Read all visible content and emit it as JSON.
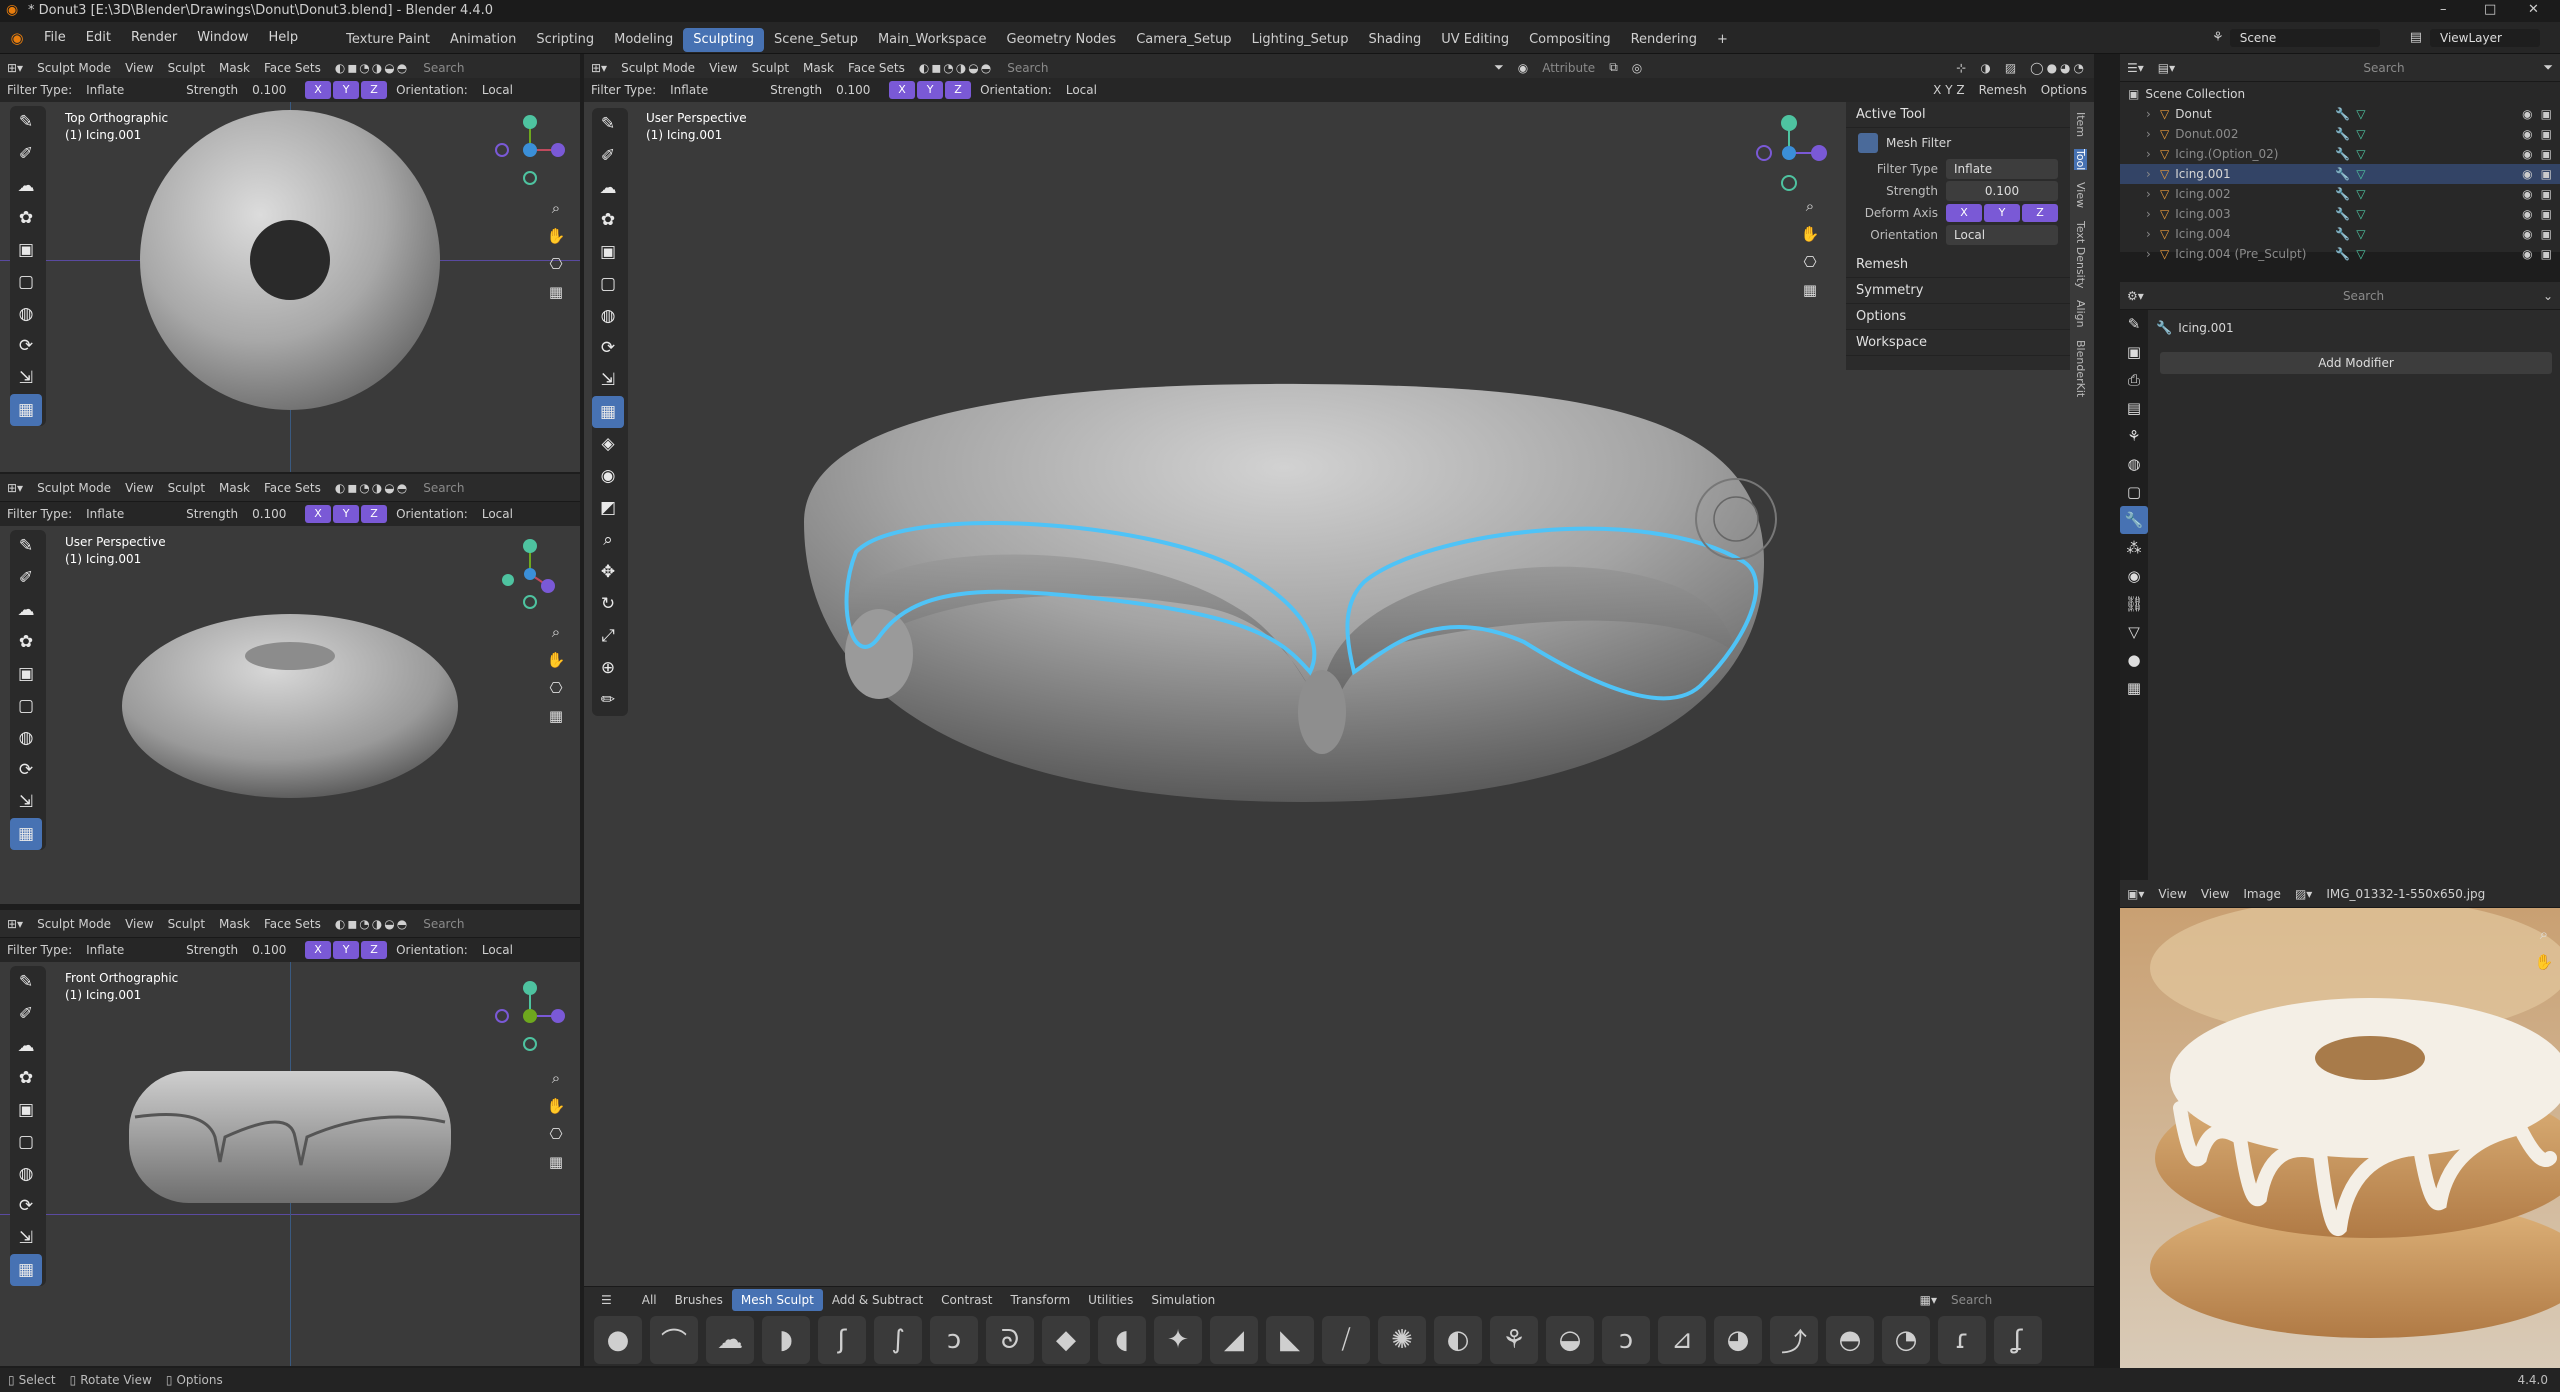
{
  "window": {
    "title": "* Donut3 [E:\\3D\\Blender\\Drawings\\Donut\\Donut3.blend] - Blender 4.4.0",
    "controls": [
      "–",
      "□",
      "✕"
    ]
  },
  "menus": [
    "File",
    "Edit",
    "Render",
    "Window",
    "Help"
  ],
  "workspaces": [
    "Texture Paint",
    "Animation",
    "Scripting",
    "Modeling",
    "Sculpting",
    "Scene_Setup",
    "Main_Workspace",
    "Geometry Nodes",
    "Camera_Setup",
    "Lighting_Setup",
    "Shading",
    "UV Editing",
    "Compositing",
    "Rendering",
    "+"
  ],
  "active_workspace": "Sculpting",
  "scene": {
    "label": "Scene",
    "view_layer": "ViewLayer"
  },
  "header": {
    "mode": "Sculpt Mode",
    "menu": [
      "View",
      "Sculpt",
      "Mask",
      "Face Sets"
    ],
    "search_placeholder": "Search",
    "attribute": "Attribute"
  },
  "tool_settings": {
    "filter_type_label": "Filter Type:",
    "filter_type": "Inflate",
    "strength_label": "Strength",
    "strength": "0.100",
    "axes": [
      "X",
      "Y",
      "Z"
    ],
    "orientation_label": "Orientation:",
    "orientation": "Local",
    "remesh": "Remesh",
    "options": "Options"
  },
  "viewports": {
    "top": {
      "view": "Top Orthographic",
      "object": "(1) Icing.001"
    },
    "left_persp": {
      "view": "User Perspective",
      "object": "(1) Icing.001"
    },
    "front": {
      "view": "Front Orthographic",
      "object": "(1) Icing.001"
    },
    "main": {
      "view": "User Perspective",
      "object": "(1) Icing.001"
    }
  },
  "active_tool_panel": {
    "title": "Active Tool",
    "tool_name": "Mesh Filter",
    "filter_type_label": "Filter Type",
    "filter_type": "Inflate",
    "strength_label": "Strength",
    "strength": "0.100",
    "deform_axis_label": "Deform Axis",
    "orientation_label": "Orientation",
    "orientation": "Local",
    "sections": [
      "Remesh",
      "Symmetry",
      "Options",
      "Workspace"
    ]
  },
  "side_tabs": [
    "Item",
    "Tool",
    "View",
    "Text Density",
    "Align",
    "BlenderKit"
  ],
  "outliner": {
    "search_placeholder": "Search",
    "root": "Scene Collection",
    "items": [
      {
        "name": "Donut",
        "dim": false
      },
      {
        "name": "Donut.002",
        "dim": true
      },
      {
        "name": "Icing.(Option_02)",
        "dim": true
      },
      {
        "name": "Icing.001",
        "dim": false
      },
      {
        "name": "Icing.002",
        "dim": true
      },
      {
        "name": "Icing.003",
        "dim": true
      },
      {
        "name": "Icing.004",
        "dim": true
      },
      {
        "name": "Icing.004 (Pre_Sculpt)",
        "dim": true
      }
    ]
  },
  "properties": {
    "search_placeholder": "Search",
    "object": "Icing.001",
    "add_modifier": "Add Modifier"
  },
  "image_editor": {
    "menu": [
      "View",
      "View",
      "Image"
    ],
    "image_name": "IMG_01332-1-550x650.jpg"
  },
  "asset_shelf": {
    "tabs": [
      "All",
      "Brushes",
      "Mesh Sculpt",
      "Add & Subtract",
      "Contrast",
      "Transform",
      "Utilities",
      "Simulation"
    ],
    "active_tab": "Mesh Sculpt",
    "search_placeholder": "Search",
    "brush_count": 26
  },
  "statusbar": {
    "items": [
      "Select",
      "Rotate View",
      "Options"
    ],
    "version": "4.4.0"
  },
  "colors": {
    "accent": "#4772b3",
    "axis_purple": "#7a59d6",
    "annotation": "#4fc3f7"
  }
}
